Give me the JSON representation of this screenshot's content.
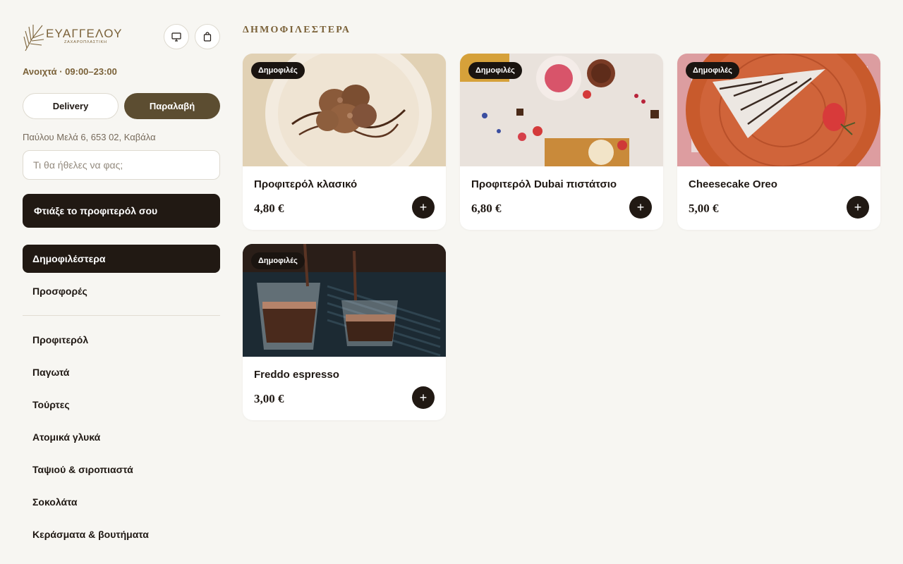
{
  "brand": {
    "name": "ΕΥΑΓΓΕΛΟΥ",
    "tagline": "ΖΑΧΑΡΟΠΛΑΣΤΙΚΗ"
  },
  "header_icons": {
    "desktop": "desktop-icon",
    "cart": "cart-icon"
  },
  "store": {
    "hours": "Ανοιχτά · 09:00–23:00",
    "address": "Παύλου Μελά 6, 653 02, Καβάλα"
  },
  "mode": {
    "delivery_label": "Delivery",
    "pickup_label": "Παραλαβή",
    "selected": "pickup"
  },
  "search": {
    "placeholder": "Τι θα ήθελες να φας;"
  },
  "cta": {
    "label": "Φτιάξε το προφιτερόλ σου"
  },
  "nav": {
    "featured": [
      {
        "label": "Δημοφιλέστερα",
        "active": true
      },
      {
        "label": "Προσφορές",
        "active": false
      }
    ],
    "categories": [
      "Προφιτερόλ",
      "Παγωτά",
      "Τούρτες",
      "Ατομικά γλυκά",
      "Ταψιού & σιροπιαστά",
      "Σοκολάτα",
      "Κεράσματα & βουτήματα"
    ]
  },
  "section": {
    "title": "ΔΗΜΟΦΙΛΕΣΤΕΡΑ"
  },
  "products": [
    {
      "name": "Προφιτερόλ κλασικό",
      "price": "4,80 €",
      "badge": "Δημοφιλές",
      "add": "+"
    },
    {
      "name": "Προφιτερόλ Dubai πιστάτσιο",
      "price": "6,80 €",
      "badge": "Δημοφιλές",
      "add": "+"
    },
    {
      "name": "Cheesecake Oreo",
      "price": "5,00 €",
      "badge": "Δημοφιλές",
      "add": "+"
    },
    {
      "name": "Freddo espresso",
      "price": "3,00 €",
      "badge": "Δημοφιλές",
      "add": "+"
    }
  ],
  "colors": {
    "accent_gold": "#7a6138",
    "dark": "#211913",
    "pickup_active": "#5c4d31",
    "background": "#f7f6f2"
  }
}
